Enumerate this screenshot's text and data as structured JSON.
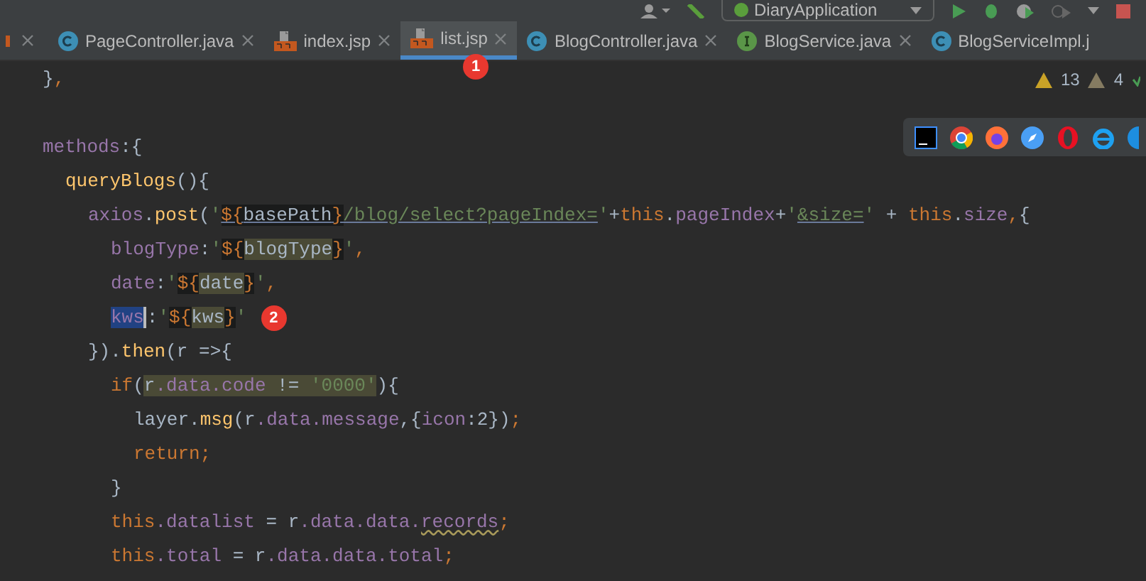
{
  "toolbar": {
    "run_config": "DiaryApplication"
  },
  "tabs": [
    {
      "label": "PageController.java",
      "kind": "class",
      "selected": false
    },
    {
      "label": "index.jsp",
      "kind": "jsp",
      "selected": false
    },
    {
      "label": "list.jsp",
      "kind": "jsp",
      "selected": true,
      "badge": "1"
    },
    {
      "label": "BlogController.java",
      "kind": "class",
      "selected": false
    },
    {
      "label": "BlogService.java",
      "kind": "interface",
      "selected": false
    },
    {
      "label": "BlogServiceImpl.j",
      "kind": "class",
      "selected": false
    }
  ],
  "inspections": {
    "warnings": "13",
    "weak_warnings": "4"
  },
  "code": [
    {
      "kind": "code",
      "tokens": [
        {
          "text": "}",
          "kind": "plain"
        },
        {
          "text": ",",
          "kind": "kw"
        }
      ]
    },
    {
      "kind": "blank"
    },
    {
      "kind": "code",
      "tokens": [
        {
          "text": "methods",
          "kind": "prop"
        },
        {
          "text": ":{",
          "kind": "plain"
        }
      ],
      "children": [
        {
          "kind": "code",
          "tokens": [
            {
              "text": "queryBlogs",
              "kind": "fn"
            },
            {
              "text": "(){",
              "kind": "plain"
            }
          ],
          "children": [
            {
              "kind": "code",
              "tokens": [
                {
                  "text": "axios",
                  "kind": "prop"
                },
                {
                  "text": ".",
                  "kind": "plain"
                },
                {
                  "text": "post",
                  "kind": "fn"
                },
                {
                  "text": "(",
                  "kind": "plain"
                },
                {
                  "text": "'",
                  "kind": "str"
                },
                {
                  "text": "${",
                  "kind": "kw",
                  "template": true,
                  "ul": true
                },
                {
                  "text": "basePath",
                  "kind": "plain",
                  "template": true,
                  "ul": true
                },
                {
                  "text": "}",
                  "kind": "kw",
                  "template": true,
                  "ul": true
                },
                {
                  "text": "/blog/select?pageIndex=",
                  "kind": "str",
                  "ul": true
                },
                {
                  "text": "'",
                  "kind": "str"
                },
                {
                  "text": "+",
                  "kind": "plain"
                },
                {
                  "text": "this",
                  "kind": "kw"
                },
                {
                  "text": ".",
                  "kind": "plain"
                },
                {
                  "text": "pageIndex",
                  "kind": "prop"
                },
                {
                  "text": "+",
                  "kind": "plain"
                },
                {
                  "text": "'",
                  "kind": "str"
                },
                {
                  "text": "&size=",
                  "kind": "str",
                  "ul": true
                },
                {
                  "text": "' ",
                  "kind": "str"
                },
                {
                  "text": "+ ",
                  "kind": "plain"
                },
                {
                  "text": "this",
                  "kind": "kw"
                },
                {
                  "text": ".",
                  "kind": "plain"
                },
                {
                  "text": "size",
                  "kind": "prop"
                },
                {
                  "text": ",",
                  "kind": "kw"
                },
                {
                  "text": "{",
                  "kind": "plain"
                }
              ],
              "children": [
                {
                  "kind": "code",
                  "tokens": [
                    {
                      "text": "blogType",
                      "kind": "prop"
                    },
                    {
                      "text": ":",
                      "kind": "plain"
                    },
                    {
                      "text": "'",
                      "kind": "str"
                    },
                    {
                      "text": "${",
                      "kind": "kw",
                      "template": true
                    },
                    {
                      "text": "blogType",
                      "kind": "plain",
                      "usage": true
                    },
                    {
                      "text": "}",
                      "kind": "kw",
                      "template": true
                    },
                    {
                      "text": "'",
                      "kind": "str"
                    },
                    {
                      "text": ",",
                      "kind": "kw"
                    }
                  ]
                },
                {
                  "kind": "code",
                  "tokens": [
                    {
                      "text": "date",
                      "kind": "prop"
                    },
                    {
                      "text": ":",
                      "kind": "plain"
                    },
                    {
                      "text": "'",
                      "kind": "str"
                    },
                    {
                      "text": "${",
                      "kind": "kw",
                      "template": true
                    },
                    {
                      "text": "date",
                      "kind": "plain",
                      "usage": true
                    },
                    {
                      "text": "}",
                      "kind": "kw",
                      "template": true
                    },
                    {
                      "text": "'",
                      "kind": "str"
                    },
                    {
                      "text": ",",
                      "kind": "kw"
                    }
                  ]
                },
                {
                  "kind": "code",
                  "badge": "2",
                  "tokens": [
                    {
                      "text": "kws",
                      "kind": "prop",
                      "selected_text": true,
                      "caret": true
                    },
                    {
                      "text": ":",
                      "kind": "plain"
                    },
                    {
                      "text": "'",
                      "kind": "str"
                    },
                    {
                      "text": "${",
                      "kind": "kw",
                      "template": true
                    },
                    {
                      "text": "kws",
                      "kind": "plain",
                      "usage": true
                    },
                    {
                      "text": "}",
                      "kind": "kw",
                      "template": true
                    },
                    {
                      "text": "'",
                      "kind": "str"
                    }
                  ]
                }
              ]
            },
            {
              "kind": "code",
              "tokens": [
                {
                  "text": "}).",
                  "kind": "plain"
                },
                {
                  "text": "then",
                  "kind": "fn"
                },
                {
                  "text": "(r =>{",
                  "kind": "plain"
                }
              ],
              "children": [
                {
                  "kind": "code",
                  "tokens": [
                    {
                      "text": "if",
                      "kind": "kw"
                    },
                    {
                      "text": "(",
                      "kind": "plain"
                    },
                    {
                      "text": "r",
                      "kind": "plain",
                      "usage": true
                    },
                    {
                      "text": ".data.code",
                      "kind": "prop",
                      "usage": true
                    },
                    {
                      "text": " != ",
                      "kind": "plain",
                      "usage": true
                    },
                    {
                      "text": "'0000'",
                      "kind": "str",
                      "usage": true
                    },
                    {
                      "text": "){",
                      "kind": "plain"
                    }
                  ],
                  "children": [
                    {
                      "kind": "code",
                      "tokens": [
                        {
                          "text": "layer.",
                          "kind": "plain"
                        },
                        {
                          "text": "msg",
                          "kind": "fn"
                        },
                        {
                          "text": "(r",
                          "kind": "plain"
                        },
                        {
                          "text": ".data.message",
                          "kind": "prop"
                        },
                        {
                          "text": ",{",
                          "kind": "plain"
                        },
                        {
                          "text": "icon",
                          "kind": "prop"
                        },
                        {
                          "text": ":2})",
                          "kind": "plain"
                        },
                        {
                          "text": ";",
                          "kind": "kw"
                        }
                      ]
                    },
                    {
                      "kind": "code",
                      "tokens": [
                        {
                          "text": "return;",
                          "kind": "kw"
                        }
                      ]
                    }
                  ]
                },
                {
                  "kind": "code",
                  "tokens": [
                    {
                      "text": "}",
                      "kind": "plain"
                    }
                  ]
                },
                {
                  "kind": "code",
                  "tokens": [
                    {
                      "text": "this",
                      "kind": "kw"
                    },
                    {
                      "text": ".datalist",
                      "kind": "prop"
                    },
                    {
                      "text": " = r",
                      "kind": "plain"
                    },
                    {
                      "text": ".data.data.",
                      "kind": "prop"
                    },
                    {
                      "text": "records",
                      "kind": "prop",
                      "warn": true
                    },
                    {
                      "text": ";",
                      "kind": "kw"
                    }
                  ]
                },
                {
                  "kind": "code",
                  "tokens": [
                    {
                      "text": "this",
                      "kind": "kw"
                    },
                    {
                      "text": ".total",
                      "kind": "prop"
                    },
                    {
                      "text": " = r",
                      "kind": "plain"
                    },
                    {
                      "text": ".data.data.total",
                      "kind": "prop"
                    },
                    {
                      "text": ";",
                      "kind": "kw"
                    }
                  ]
                }
              ]
            }
          ]
        }
      ]
    }
  ]
}
